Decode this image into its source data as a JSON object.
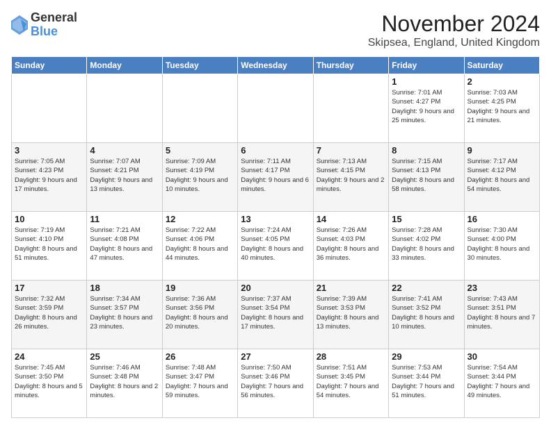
{
  "logo": {
    "general": "General",
    "blue": "Blue"
  },
  "title": "November 2024",
  "subtitle": "Skipsea, England, United Kingdom",
  "weekdays": [
    "Sunday",
    "Monday",
    "Tuesday",
    "Wednesday",
    "Thursday",
    "Friday",
    "Saturday"
  ],
  "weeks": [
    [
      {
        "day": "",
        "info": ""
      },
      {
        "day": "",
        "info": ""
      },
      {
        "day": "",
        "info": ""
      },
      {
        "day": "",
        "info": ""
      },
      {
        "day": "",
        "info": ""
      },
      {
        "day": "1",
        "info": "Sunrise: 7:01 AM\nSunset: 4:27 PM\nDaylight: 9 hours and 25 minutes."
      },
      {
        "day": "2",
        "info": "Sunrise: 7:03 AM\nSunset: 4:25 PM\nDaylight: 9 hours and 21 minutes."
      }
    ],
    [
      {
        "day": "3",
        "info": "Sunrise: 7:05 AM\nSunset: 4:23 PM\nDaylight: 9 hours and 17 minutes."
      },
      {
        "day": "4",
        "info": "Sunrise: 7:07 AM\nSunset: 4:21 PM\nDaylight: 9 hours and 13 minutes."
      },
      {
        "day": "5",
        "info": "Sunrise: 7:09 AM\nSunset: 4:19 PM\nDaylight: 9 hours and 10 minutes."
      },
      {
        "day": "6",
        "info": "Sunrise: 7:11 AM\nSunset: 4:17 PM\nDaylight: 9 hours and 6 minutes."
      },
      {
        "day": "7",
        "info": "Sunrise: 7:13 AM\nSunset: 4:15 PM\nDaylight: 9 hours and 2 minutes."
      },
      {
        "day": "8",
        "info": "Sunrise: 7:15 AM\nSunset: 4:13 PM\nDaylight: 8 hours and 58 minutes."
      },
      {
        "day": "9",
        "info": "Sunrise: 7:17 AM\nSunset: 4:12 PM\nDaylight: 8 hours and 54 minutes."
      }
    ],
    [
      {
        "day": "10",
        "info": "Sunrise: 7:19 AM\nSunset: 4:10 PM\nDaylight: 8 hours and 51 minutes."
      },
      {
        "day": "11",
        "info": "Sunrise: 7:21 AM\nSunset: 4:08 PM\nDaylight: 8 hours and 47 minutes."
      },
      {
        "day": "12",
        "info": "Sunrise: 7:22 AM\nSunset: 4:06 PM\nDaylight: 8 hours and 44 minutes."
      },
      {
        "day": "13",
        "info": "Sunrise: 7:24 AM\nSunset: 4:05 PM\nDaylight: 8 hours and 40 minutes."
      },
      {
        "day": "14",
        "info": "Sunrise: 7:26 AM\nSunset: 4:03 PM\nDaylight: 8 hours and 36 minutes."
      },
      {
        "day": "15",
        "info": "Sunrise: 7:28 AM\nSunset: 4:02 PM\nDaylight: 8 hours and 33 minutes."
      },
      {
        "day": "16",
        "info": "Sunrise: 7:30 AM\nSunset: 4:00 PM\nDaylight: 8 hours and 30 minutes."
      }
    ],
    [
      {
        "day": "17",
        "info": "Sunrise: 7:32 AM\nSunset: 3:59 PM\nDaylight: 8 hours and 26 minutes."
      },
      {
        "day": "18",
        "info": "Sunrise: 7:34 AM\nSunset: 3:57 PM\nDaylight: 8 hours and 23 minutes."
      },
      {
        "day": "19",
        "info": "Sunrise: 7:36 AM\nSunset: 3:56 PM\nDaylight: 8 hours and 20 minutes."
      },
      {
        "day": "20",
        "info": "Sunrise: 7:37 AM\nSunset: 3:54 PM\nDaylight: 8 hours and 17 minutes."
      },
      {
        "day": "21",
        "info": "Sunrise: 7:39 AM\nSunset: 3:53 PM\nDaylight: 8 hours and 13 minutes."
      },
      {
        "day": "22",
        "info": "Sunrise: 7:41 AM\nSunset: 3:52 PM\nDaylight: 8 hours and 10 minutes."
      },
      {
        "day": "23",
        "info": "Sunrise: 7:43 AM\nSunset: 3:51 PM\nDaylight: 8 hours and 7 minutes."
      }
    ],
    [
      {
        "day": "24",
        "info": "Sunrise: 7:45 AM\nSunset: 3:50 PM\nDaylight: 8 hours and 5 minutes."
      },
      {
        "day": "25",
        "info": "Sunrise: 7:46 AM\nSunset: 3:48 PM\nDaylight: 8 hours and 2 minutes."
      },
      {
        "day": "26",
        "info": "Sunrise: 7:48 AM\nSunset: 3:47 PM\nDaylight: 7 hours and 59 minutes."
      },
      {
        "day": "27",
        "info": "Sunrise: 7:50 AM\nSunset: 3:46 PM\nDaylight: 7 hours and 56 minutes."
      },
      {
        "day": "28",
        "info": "Sunrise: 7:51 AM\nSunset: 3:45 PM\nDaylight: 7 hours and 54 minutes."
      },
      {
        "day": "29",
        "info": "Sunrise: 7:53 AM\nSunset: 3:44 PM\nDaylight: 7 hours and 51 minutes."
      },
      {
        "day": "30",
        "info": "Sunrise: 7:54 AM\nSunset: 3:44 PM\nDaylight: 7 hours and 49 minutes."
      }
    ]
  ]
}
